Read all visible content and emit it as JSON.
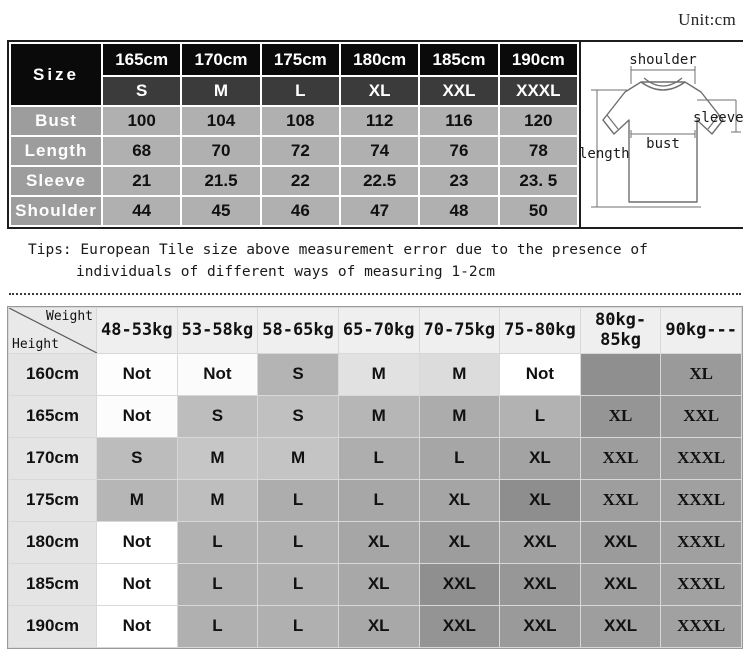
{
  "unit": {
    "label": "Unit:cm"
  },
  "size_table": {
    "corner_label": "Size",
    "heights": [
      "165cm",
      "170cm",
      "175cm",
      "180cm",
      "185cm",
      "190cm"
    ],
    "codes": [
      "S",
      "M",
      "L",
      "XL",
      "XXL",
      "XXXL"
    ],
    "rows": [
      {
        "label": "Bust",
        "values": [
          "100",
          "104",
          "108",
          "112",
          "116",
          "120"
        ]
      },
      {
        "label": "Length",
        "values": [
          "68",
          "70",
          "72",
          "74",
          "76",
          "78"
        ]
      },
      {
        "label": "Sleeve",
        "values": [
          "21",
          "21.5",
          "22",
          "22.5",
          "23",
          "23. 5"
        ]
      },
      {
        "label": "Shoulder",
        "values": [
          "44",
          "45",
          "46",
          "47",
          "48",
          "50"
        ]
      }
    ]
  },
  "tee_diagram": {
    "shoulder_label": "shoulder",
    "sleeve_label": "sleeve",
    "bust_label": "bust",
    "length_label": "length"
  },
  "tips": {
    "line1": "Tips: European Tile size above measurement error due to the presence of",
    "line2": "individuals of different ways of measuring 1-2cm"
  },
  "fit_table": {
    "corner_weight": "Weight",
    "corner_height": "Height",
    "weights": [
      "48-53kg",
      "53-58kg",
      "58-65kg",
      "65-70kg",
      "70-75kg",
      "75-80kg",
      "80kg-85kg",
      "90kg---"
    ],
    "rows": [
      {
        "height": "160cm",
        "cells": [
          {
            "text": "Not",
            "shade": "#fdfdfd"
          },
          {
            "text": "Not",
            "shade": "#fbfbfb"
          },
          {
            "text": "S",
            "shade": "#b4b4b4"
          },
          {
            "text": "M",
            "shade": "#e1e1e1"
          },
          {
            "text": "M",
            "shade": "#dcdcdc"
          },
          {
            "text": "Not",
            "shade": "#ffffff"
          },
          {
            "text": "",
            "shade": "#8f8f8f"
          },
          {
            "text": "XL",
            "shade": "#9a9a9a",
            "serif": true
          }
        ]
      },
      {
        "height": "165cm",
        "cells": [
          {
            "text": "Not",
            "shade": "#fcfcfc"
          },
          {
            "text": "S",
            "shade": "#bdbdbd"
          },
          {
            "text": "S",
            "shade": "#c0c0c0"
          },
          {
            "text": "M",
            "shade": "#b6b6b6"
          },
          {
            "text": "M",
            "shade": "#acacac"
          },
          {
            "text": "L",
            "shade": "#b2b2b2"
          },
          {
            "text": "XL",
            "shade": "#959595",
            "serif": true
          },
          {
            "text": "XXL",
            "shade": "#9b9b9b",
            "serif": true
          }
        ]
      },
      {
        "height": "170cm",
        "cells": [
          {
            "text": "S",
            "shade": "#bcbcbc"
          },
          {
            "text": "M",
            "shade": "#c6c6c6"
          },
          {
            "text": "M",
            "shade": "#c4c4c4"
          },
          {
            "text": "L",
            "shade": "#aeaeae"
          },
          {
            "text": "L",
            "shade": "#a6a6a6"
          },
          {
            "text": "XL",
            "shade": "#a3a3a3"
          },
          {
            "text": "XXL",
            "shade": "#9d9d9d",
            "serif": true
          },
          {
            "text": "XXXL",
            "shade": "#9e9e9e",
            "serif": true
          }
        ]
      },
      {
        "height": "175cm",
        "cells": [
          {
            "text": "M",
            "shade": "#b6b6b6"
          },
          {
            "text": "M",
            "shade": "#bebebe"
          },
          {
            "text": "L",
            "shade": "#adadad"
          },
          {
            "text": "L",
            "shade": "#a7a7a7"
          },
          {
            "text": "XL",
            "shade": "#a5a5a5"
          },
          {
            "text": "XL",
            "shade": "#8e8e8e"
          },
          {
            "text": "XXL",
            "shade": "#9e9e9e",
            "serif": true
          },
          {
            "text": "XXXL",
            "shade": "#a0a0a0",
            "serif": true
          }
        ]
      },
      {
        "height": "180cm",
        "cells": [
          {
            "text": "Not",
            "shade": "#ffffff"
          },
          {
            "text": "L",
            "shade": "#b2b2b2"
          },
          {
            "text": "L",
            "shade": "#b0b0b0"
          },
          {
            "text": "XL",
            "shade": "#a6a6a6"
          },
          {
            "text": "XL",
            "shade": "#9d9d9d"
          },
          {
            "text": "XXL",
            "shade": "#a0a0a0"
          },
          {
            "text": "XXL",
            "shade": "#9b9b9b"
          },
          {
            "text": "XXXL",
            "shade": "#a0a0a0",
            "serif": true
          }
        ]
      },
      {
        "height": "185cm",
        "cells": [
          {
            "text": "Not",
            "shade": "#ffffff"
          },
          {
            "text": "L",
            "shade": "#b0b0b0"
          },
          {
            "text": "L",
            "shade": "#b0b0b0"
          },
          {
            "text": "XL",
            "shade": "#a8a8a8"
          },
          {
            "text": "XXL",
            "shade": "#8f8f8f"
          },
          {
            "text": "XXL",
            "shade": "#979797"
          },
          {
            "text": "XXL",
            "shade": "#9e9e9e"
          },
          {
            "text": "XXXL",
            "shade": "#a1a1a1",
            "serif": true
          }
        ]
      },
      {
        "height": "190cm",
        "cells": [
          {
            "text": "Not",
            "shade": "#ffffff"
          },
          {
            "text": "L",
            "shade": "#b0b0b0"
          },
          {
            "text": "L",
            "shade": "#b0b0b0"
          },
          {
            "text": "XL",
            "shade": "#a8a8a8"
          },
          {
            "text": "XXL",
            "shade": "#949494"
          },
          {
            "text": "XXL",
            "shade": "#9a9a9a"
          },
          {
            "text": "XXL",
            "shade": "#9e9e9e"
          },
          {
            "text": "XXXL",
            "shade": "#a1a1a1",
            "serif": true
          }
        ]
      }
    ]
  }
}
